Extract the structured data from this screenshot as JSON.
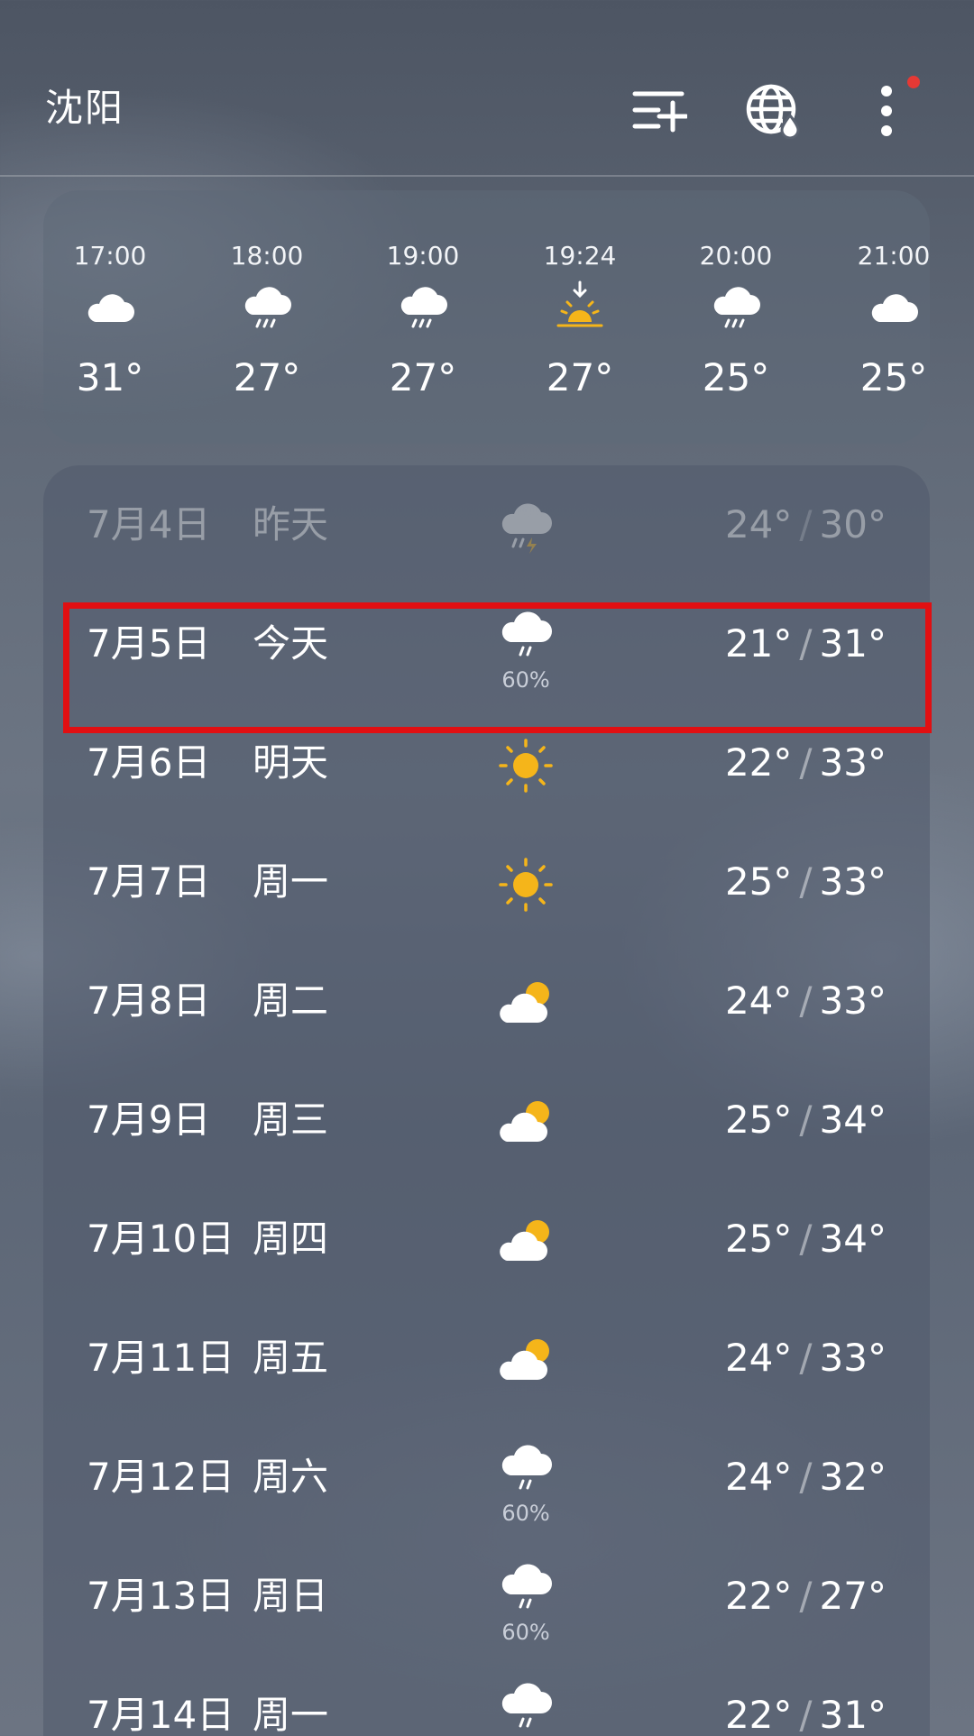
{
  "header": {
    "city": "沈阳",
    "icons": [
      "add-city-icon",
      "globe-icon",
      "more-icon"
    ],
    "notification_color": "#e53935"
  },
  "hourly": [
    {
      "time": "17:00",
      "icon": "cloud",
      "temp": "31°"
    },
    {
      "time": "18:00",
      "icon": "rain",
      "temp": "27°"
    },
    {
      "time": "19:00",
      "icon": "rain",
      "temp": "27°"
    },
    {
      "time": "19:24",
      "icon": "sunset",
      "temp": "27°"
    },
    {
      "time": "20:00",
      "icon": "rain",
      "temp": "25°"
    },
    {
      "time": "21:00",
      "icon": "cloud",
      "temp": "25°"
    }
  ],
  "daily": [
    {
      "date": "7月4日",
      "day": "昨天",
      "icon": "thunder-rain",
      "precip": "",
      "low": "24°",
      "high": "30°",
      "past": true
    },
    {
      "date": "7月5日",
      "day": "今天",
      "icon": "rain",
      "precip": "60%",
      "low": "21°",
      "high": "31°",
      "highlighted": true
    },
    {
      "date": "7月6日",
      "day": "明天",
      "icon": "sun",
      "precip": "",
      "low": "22°",
      "high": "33°"
    },
    {
      "date": "7月7日",
      "day": "周一",
      "icon": "sun",
      "precip": "",
      "low": "25°",
      "high": "33°"
    },
    {
      "date": "7月8日",
      "day": "周二",
      "icon": "partly-cloudy",
      "precip": "",
      "low": "24°",
      "high": "33°"
    },
    {
      "date": "7月9日",
      "day": "周三",
      "icon": "partly-cloudy",
      "precip": "",
      "low": "25°",
      "high": "34°"
    },
    {
      "date": "7月10日",
      "day": "周四",
      "icon": "partly-cloudy",
      "precip": "",
      "low": "25°",
      "high": "34°"
    },
    {
      "date": "7月11日",
      "day": "周五",
      "icon": "partly-cloudy",
      "precip": "",
      "low": "24°",
      "high": "33°"
    },
    {
      "date": "7月12日",
      "day": "周六",
      "icon": "rain",
      "precip": "60%",
      "low": "24°",
      "high": "32°"
    },
    {
      "date": "7月13日",
      "day": "周日",
      "icon": "rain",
      "precip": "60%",
      "low": "22°",
      "high": "27°"
    },
    {
      "date": "7月14日",
      "day": "周一",
      "icon": "rain",
      "precip": "",
      "low": "22°",
      "high": "31°"
    }
  ],
  "colors": {
    "highlight": "#e10f12",
    "sun": "#f5b51a"
  }
}
